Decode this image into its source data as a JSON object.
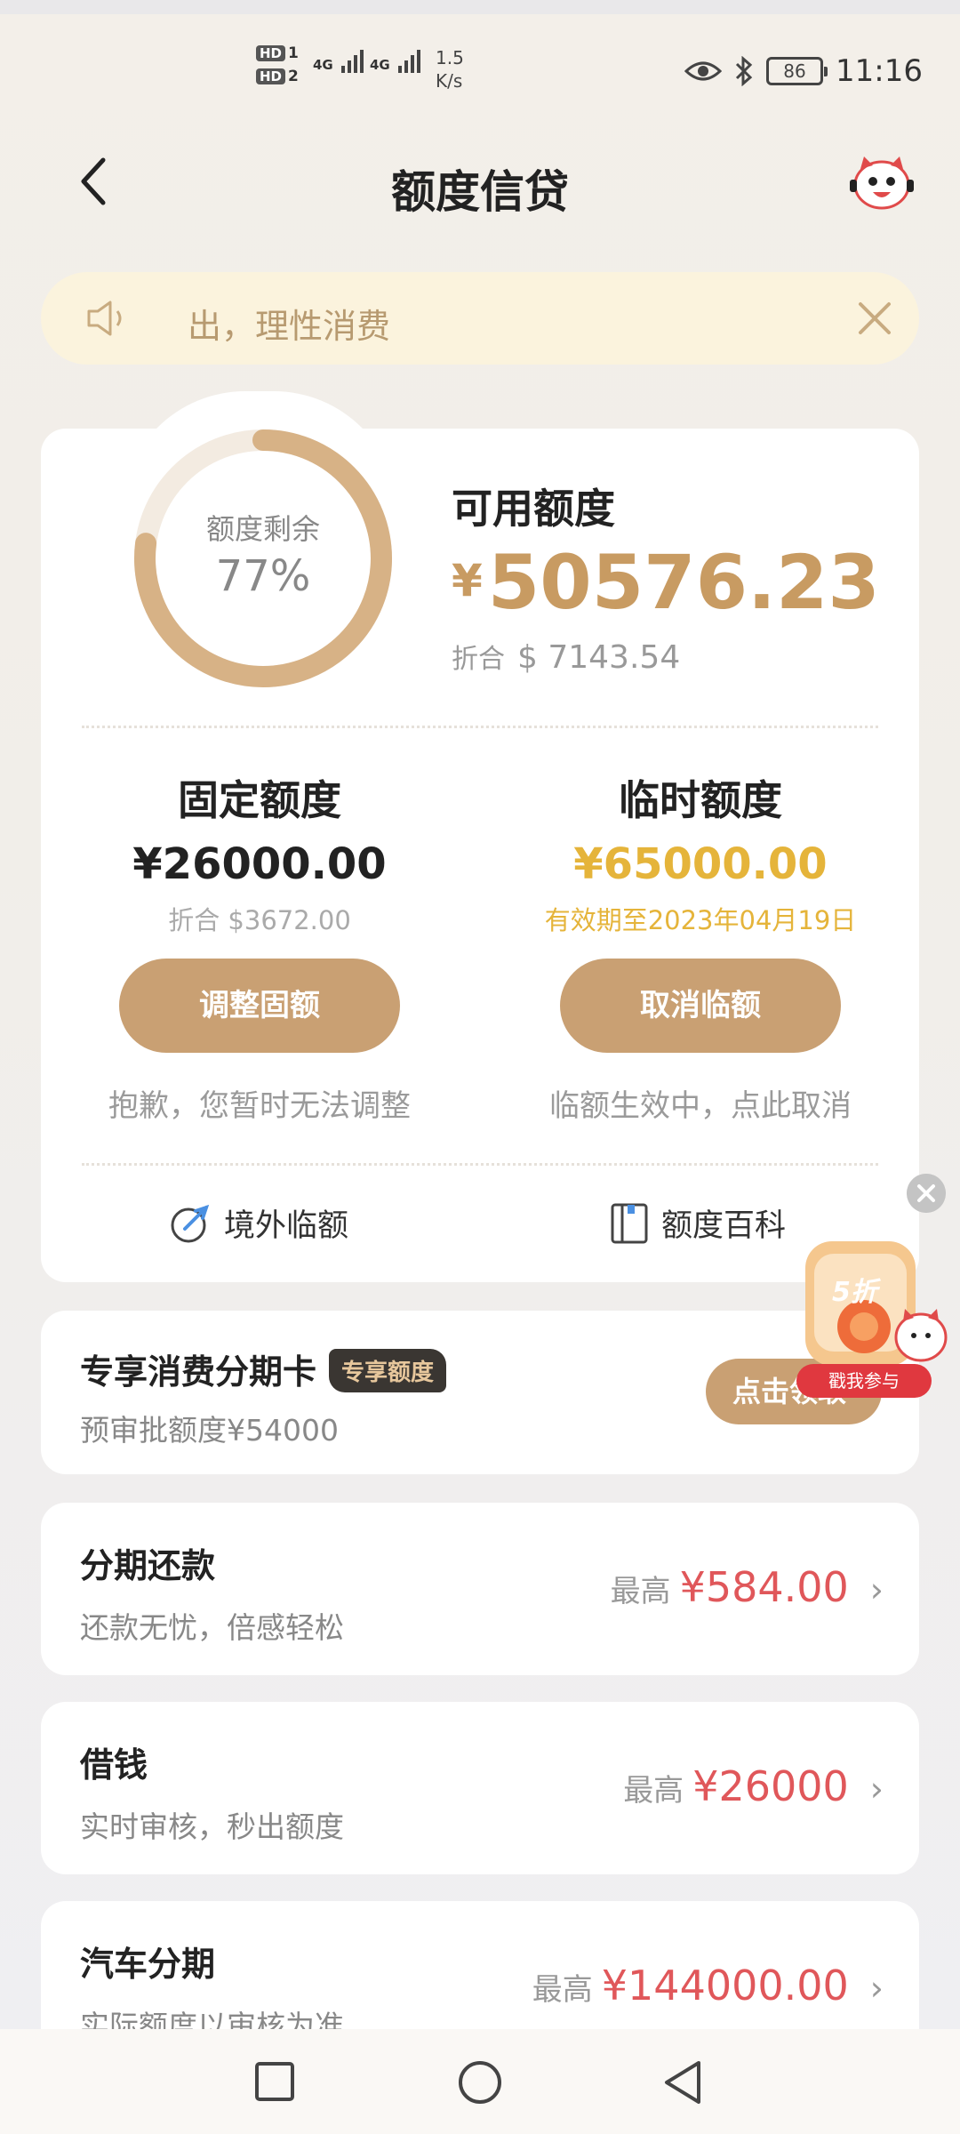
{
  "status_bar": {
    "hd1": "HD",
    "sim1": "1",
    "hd2": "HD",
    "sim2": "2",
    "net1": "4G",
    "net2": "4G",
    "speed_value": "1.5",
    "speed_unit": "K/s",
    "battery": "86",
    "time": "11:16"
  },
  "header": {
    "title": "额度信贷"
  },
  "notice": {
    "text": "出，理性消费"
  },
  "quota": {
    "ring_label": "额度剩余",
    "ring_percent": "77%",
    "ring_fraction": 0.77,
    "available_title": "可用额度",
    "available_currency": "¥",
    "available_amount": "50576.23",
    "usd_prefix": "折合",
    "usd_amount": "$ 7143.54"
  },
  "fixed": {
    "title": "固定额度",
    "amount": "¥26000.00",
    "sub": "折合 $3672.00",
    "button": "调整固额",
    "note": "抱歉，您暂时无法调整"
  },
  "temp": {
    "title": "临时额度",
    "amount": "¥65000.00",
    "sub": "有效期至2023年04月19日",
    "button": "取消临额",
    "note": "临额生效中，点此取消"
  },
  "shortcuts": {
    "overseas": "境外临额",
    "wiki": "额度百科"
  },
  "promo": {
    "discount": "5折",
    "cta": "戳我参与"
  },
  "installment_card": {
    "title": "专享消费分期卡",
    "tag": "专享额度",
    "sub": "预审批额度¥54000",
    "button": "点击领取"
  },
  "items": [
    {
      "title": "分期还款",
      "sub": "还款无忧，倍感轻松",
      "label": "最高",
      "value": "¥584.00"
    },
    {
      "title": "借钱",
      "sub": "实时审核，秒出额度",
      "label": "最高",
      "value": "¥26000"
    },
    {
      "title": "汽车分期",
      "sub": "实际额度以审核为准",
      "label": "最高",
      "value": "¥144000.00"
    }
  ],
  "colors": {
    "accent": "#c9a073",
    "gold_text": "#e5b43a",
    "price_red": "#e0575a",
    "notice_bg": "#fbf3dd"
  }
}
